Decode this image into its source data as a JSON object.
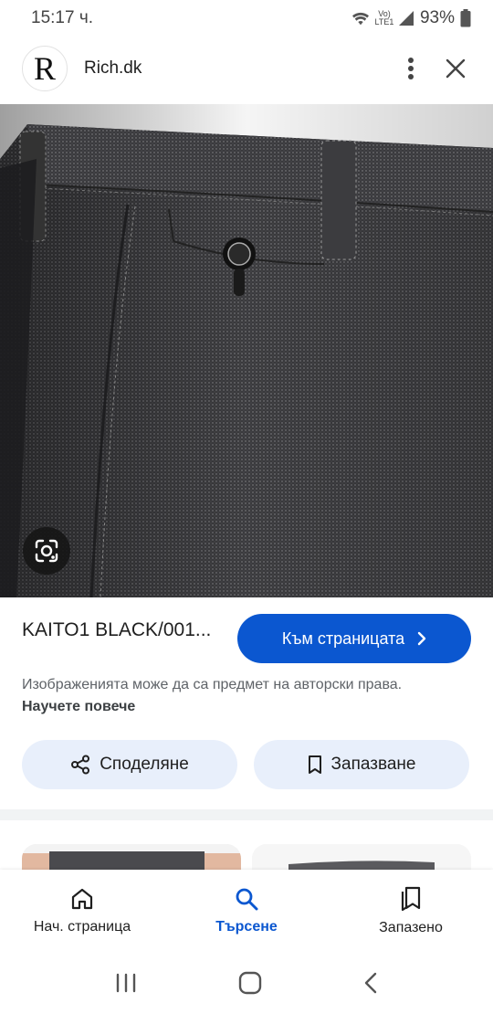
{
  "status": {
    "time": "15:17 ч.",
    "network": "Vo) LTE1",
    "battery": "93%",
    "icons": [
      "wifi-icon",
      "signal-icon",
      "battery-icon"
    ]
  },
  "header": {
    "logo_letter": "R",
    "site": "Rich.dk",
    "icons": [
      "more-vert-icon",
      "close-icon"
    ]
  },
  "product": {
    "title": "KAITO1 BLACK/001...",
    "visit_label": "Към страницата",
    "copyright_text": "Изображенията може да са предмет на авторски права.",
    "learn_more": "Научете повече"
  },
  "actions": {
    "share_label": "Споделяне",
    "save_label": "Запазване"
  },
  "nav": {
    "items": [
      {
        "label": "Нач. страница",
        "icon": "home-icon"
      },
      {
        "label": "Търсене",
        "icon": "search-icon"
      },
      {
        "label": "Запазено",
        "icon": "saved-icon"
      }
    ]
  },
  "colors": {
    "accent": "#0b57d0",
    "pill_bg": "#e8effb",
    "fabric": "#3d3d40"
  }
}
